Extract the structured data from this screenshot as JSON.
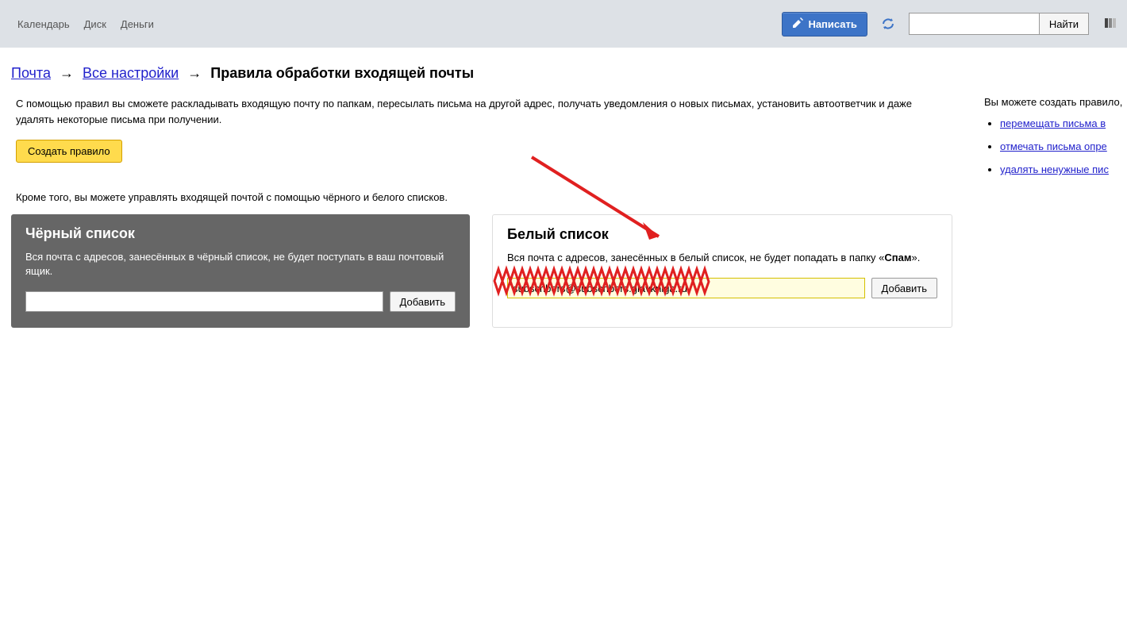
{
  "topbar": {
    "nav": [
      "Календарь",
      "Диск",
      "Деньги"
    ],
    "compose": "Написать",
    "search_placeholder": "",
    "search_btn": "Найти"
  },
  "breadcrumb": {
    "mail": "Почта",
    "settings": "Все настройки",
    "current": "Правила обработки входящей почты"
  },
  "intro": "С помощью правил вы сможете раскладывать входящую почту по папкам, пересылать письма на другой адрес, получать уведомления о новых письмах, установить автоответчик и даже удалять некоторые письма при получении.",
  "create_rule": "Создать правило",
  "sub_text": "Кроме того, вы можете управлять входящей почтой с помощью чёрного и белого списков.",
  "blacklist": {
    "title": "Чёрный список",
    "desc": "Вся почта с адресов, занесённых в чёрный список, не будет поступать в ваш почтовый ящик.",
    "input_value": "",
    "add": "Добавить"
  },
  "whitelist": {
    "title": "Белый список",
    "desc_pre": "Вся почта с адресов, занесённых в белый список, не будет попадать в папку «",
    "desc_bold": "Спам",
    "desc_post": "».",
    "input_value": "subscribers@subscribers.glavkniga.ru",
    "add": "Добавить"
  },
  "sidebar": {
    "title": "Вы можете создать правило,",
    "items": [
      "перемещать письма в",
      "отмечать письма опре",
      "удалять ненужные пис"
    ]
  }
}
